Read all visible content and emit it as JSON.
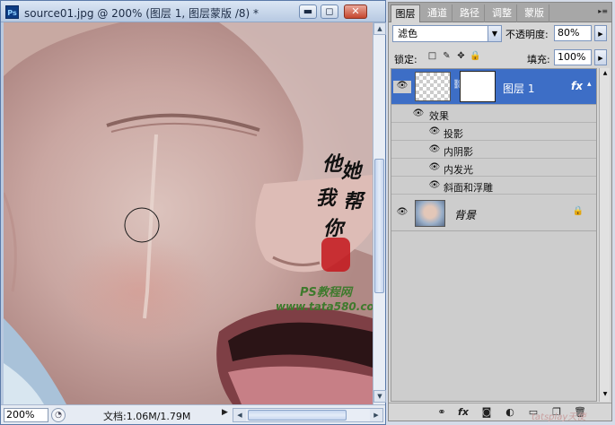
{
  "document": {
    "app_icon": "Ps",
    "title": "source01.jpg @ 200% (图层 1, 图层蒙版 /8) *",
    "window_buttons": {
      "minimize": "▬",
      "restore": "◻",
      "close": "✕"
    },
    "watermark": {
      "calligraphy": [
        "他",
        "她",
        "我",
        "帮",
        "你"
      ],
      "site_name": "PS教程网",
      "site_url": "www.tata580.com"
    },
    "status": {
      "zoom": "200%",
      "doc_info": "文档:1.06M/1.79M",
      "arrow": "▶"
    }
  },
  "layers_panel": {
    "tabs": [
      {
        "label": "图层",
        "active": true
      },
      {
        "label": "通道",
        "active": false
      },
      {
        "label": "路径",
        "active": false
      },
      {
        "label": "调整",
        "active": false
      },
      {
        "label": "蒙版",
        "active": false
      }
    ],
    "tab_menu_icon": "▸≡",
    "blend_mode": "滤色",
    "opacity_label": "不透明度:",
    "opacity": "80%",
    "lock_label": "锁定:",
    "lock_icons": [
      "□",
      "✎",
      "✥",
      "🔒"
    ],
    "fill_label": "填充:",
    "fill": "100%",
    "layers": [
      {
        "name": "图层 1",
        "selected": true,
        "fx": "fx",
        "expand": "▴"
      },
      {
        "name": "背景",
        "selected": false,
        "locked": "🔒"
      }
    ],
    "effects_header": "效果",
    "effects": [
      "投影",
      "内阴影",
      "内发光",
      "斜面和浮雕"
    ],
    "footer_icons": [
      "⚭",
      "fx",
      "◙",
      "◐",
      "▭",
      "❐",
      "🗑"
    ],
    "corner_watermark": "tatsplay天使"
  },
  "colors": {
    "selection": "#3d6ec6",
    "titlebar": "#b7c9e2",
    "panel_bg": "#d6d6d6"
  }
}
